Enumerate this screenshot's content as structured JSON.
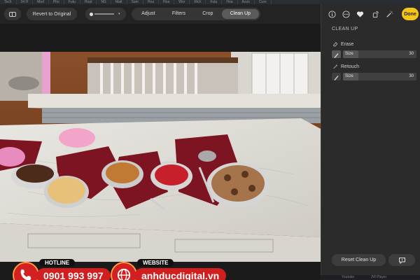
{
  "browser_tabs": [
    "Tech",
    "24 H",
    "Mod",
    "Pho",
    "Futu",
    "Hoạt",
    "NG",
    "Matt",
    "Sam",
    "Hoa",
    "Hoa",
    "Wor",
    "Rich",
    "Futu",
    "Hoa",
    "Acon",
    "Cure"
  ],
  "toolbar": {
    "revert_label": "Revert to Original",
    "tabs": [
      {
        "label": "Adjust",
        "active": false
      },
      {
        "label": "Filters",
        "active": false
      },
      {
        "label": "Crop",
        "active": false
      },
      {
        "label": "Clean Up",
        "active": true
      }
    ]
  },
  "panel": {
    "done_label": "Done",
    "title": "CLEAN UP",
    "erase": {
      "label": "Erase",
      "size_label": "Size",
      "size_value": "30"
    },
    "retouch": {
      "label": "Retouch",
      "size_label": "Size",
      "size_value": "30"
    },
    "reset_label": "Reset Clean Up"
  },
  "bottom_strip": {
    "items": [
      "Youtube",
      "JW Player"
    ]
  },
  "watermark": {
    "hotline_label": "HOTLINE",
    "phone": "0901 993 997",
    "website_label": "WEBSITE",
    "website": "anhducdigital.vn"
  },
  "colors": {
    "accent_done": "#f5c518",
    "brand_red": "#d11f1f",
    "panel_bg": "#2b2b2b"
  }
}
